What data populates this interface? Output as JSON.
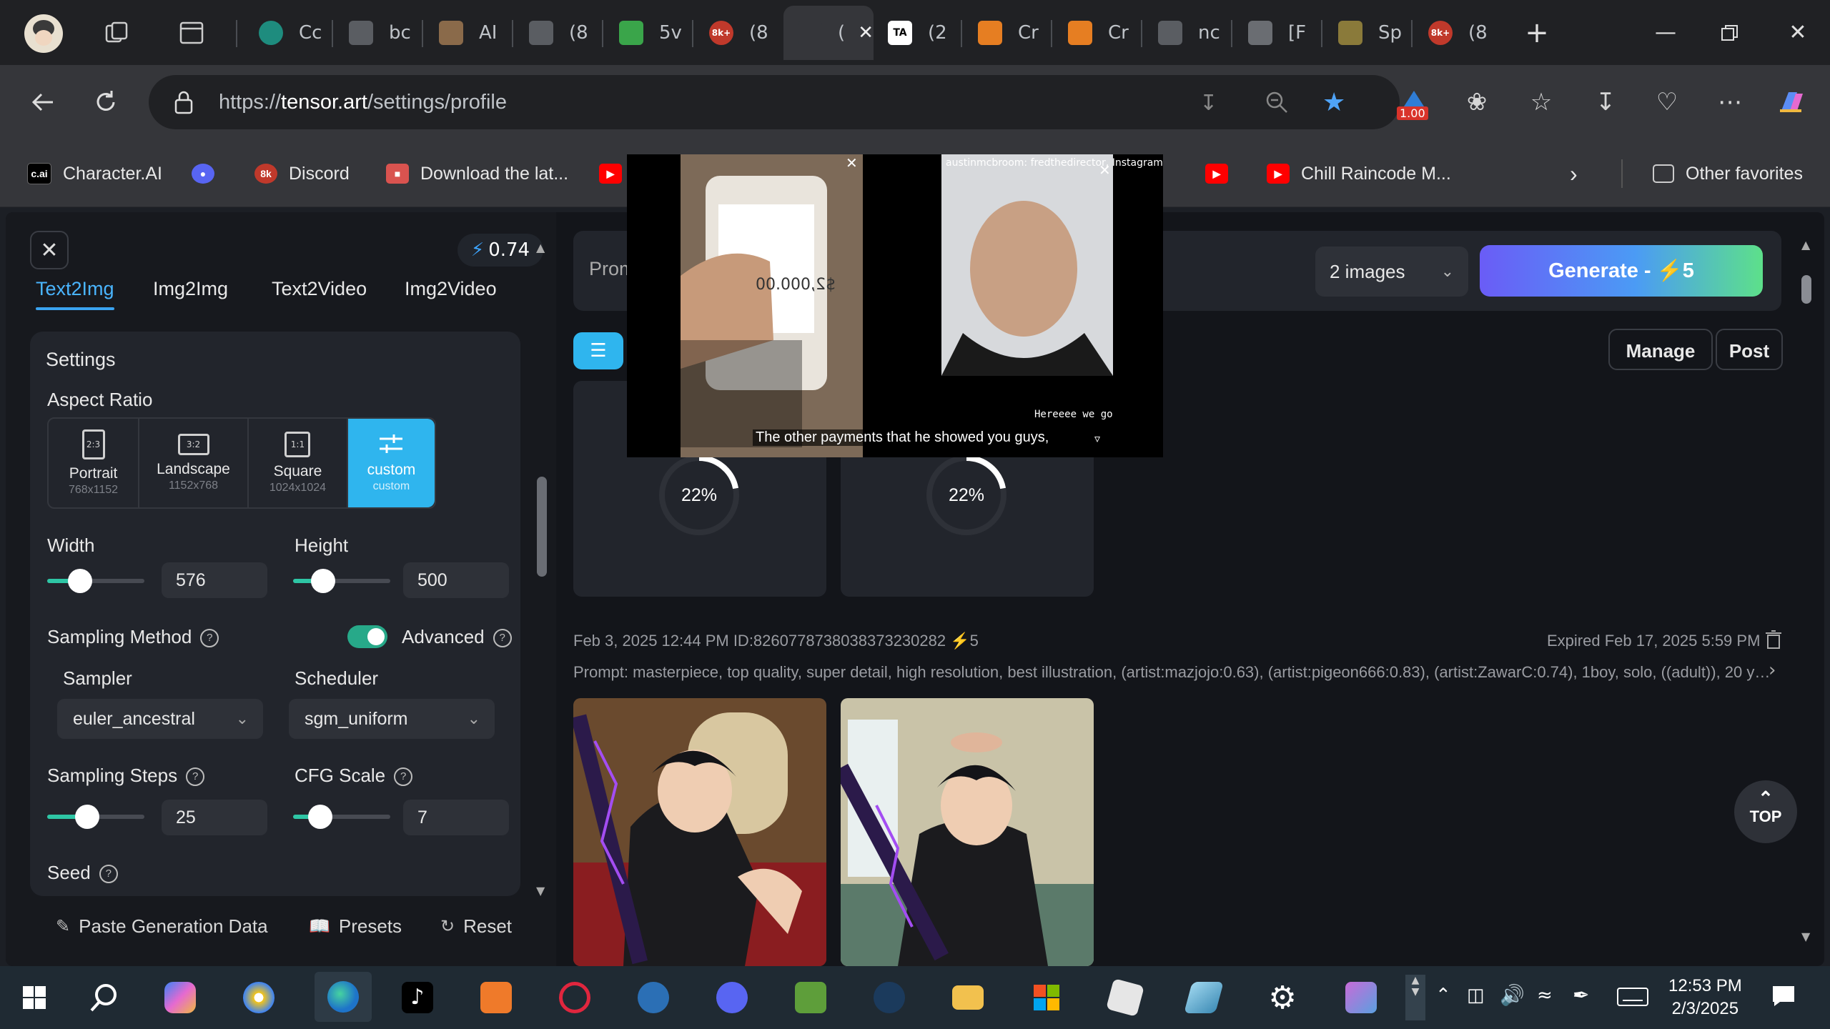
{
  "tabs": [
    {
      "title": "Cc",
      "icon": "globe-icon",
      "color": "#1e8c7e"
    },
    {
      "title": "bc",
      "icon": "document-icon",
      "color": "#5a5d62"
    },
    {
      "title": "AI",
      "icon": "avatar-icon",
      "color": "#8a6a4a"
    },
    {
      "title": "(8",
      "icon": "image-icon",
      "color": "#5a5d62"
    },
    {
      "title": "5v",
      "icon": "pinwheel-icon",
      "color": "#3aa54a"
    },
    {
      "title": "(8",
      "icon": "8k-icon",
      "color": "#c0392b"
    },
    {
      "title": "(",
      "icon": "blank-icon",
      "color": "#35363a"
    },
    {
      "title": "(2",
      "icon": "tensor-icon",
      "color": "#ffffff"
    },
    {
      "title": "Cr",
      "icon": "pencil-icon",
      "color": "#e67e22"
    },
    {
      "title": "Cr",
      "icon": "pencil-icon",
      "color": "#e67e22"
    },
    {
      "title": "nc",
      "icon": "document-icon",
      "color": "#5a5d62"
    },
    {
      "title": "[F",
      "icon": "roblox-icon",
      "color": "#6a6d72"
    },
    {
      "title": "Sp",
      "icon": "character-icon",
      "color": "#8a7a3a"
    },
    {
      "title": "(8",
      "icon": "8k-icon",
      "color": "#c0392b"
    }
  ],
  "browser": {
    "url_prefix": "https://",
    "url_domain": "tensor.art",
    "url_path": "/settings/profile",
    "extension_badge": "1.00"
  },
  "bookmarks": [
    {
      "label": "Character.AI",
      "icon": "cai-icon"
    },
    {
      "label": "",
      "icon": "discord-icon"
    },
    {
      "label": "Discord",
      "icon": "8k-icon"
    },
    {
      "label": "Download the lat...",
      "icon": "download-icon"
    },
    {
      "label": "Chill Raincode M...",
      "icon": "youtube-icon"
    },
    {
      "label": "Other favorites",
      "icon": "folder-icon"
    }
  ],
  "app": {
    "credits": "0.74",
    "modes": [
      "Text2Img",
      "Img2Img",
      "Text2Video",
      "Img2Video"
    ],
    "settings_title": "Settings",
    "aspect_ratio_label": "Aspect Ratio",
    "aspects": [
      {
        "ratio": "2:3",
        "name": "Portrait",
        "dims": "768x1152"
      },
      {
        "ratio": "3:2",
        "name": "Landscape",
        "dims": "1152x768"
      },
      {
        "ratio": "1:1",
        "name": "Square",
        "dims": "1024x1024"
      },
      {
        "ratio": "",
        "name": "custom",
        "dims": "custom"
      }
    ],
    "width_label": "Width",
    "width_value": "576",
    "height_label": "Height",
    "height_value": "500",
    "sampling_method_label": "Sampling Method",
    "advanced_label": "Advanced",
    "sampler_label": "Sampler",
    "sampler_value": "euler_ancestral",
    "scheduler_label": "Scheduler",
    "scheduler_value": "sgm_uniform",
    "steps_label": "Sampling Steps",
    "steps_value": "25",
    "cfg_label": "CFG Scale",
    "cfg_value": "7",
    "seed_label": "Seed",
    "paste_label": "Paste Generation Data",
    "presets_label": "Presets",
    "reset_label": "Reset",
    "prompt_placeholder": "Prom",
    "images_select": "2 images",
    "generate_label": "Generate - ",
    "generate_cost": "5",
    "manage_label": "Manage",
    "post_label": "Post",
    "progress_1": "22%",
    "progress_2": "22%",
    "task_meta": "Feb 3, 2025 12:44 PM ID:826077873803837323028​2",
    "task_cost": "5",
    "expired": "Expired Feb 17, 2025 5:59 PM",
    "prompt_text": "Prompt: masterpiece, top quality, super detail, high resolution, best illustration, (artist:mazjojo:0.63), (artist:pigeon666:0.83), (artist:ZawarC:0.74), 1boy, solo, ((adult)), 20 year...",
    "top_label": "TOP"
  },
  "overlay": {
    "caption": "The other payments that he showed you guys,",
    "insta_header": "austinmcbroom: fredthedirector, Instagram",
    "phone_amount": "$2,000.00",
    "right_caption": "Hereeee we go"
  },
  "taskbar": {
    "time": "12:53 PM",
    "date": "2/3/2025"
  }
}
